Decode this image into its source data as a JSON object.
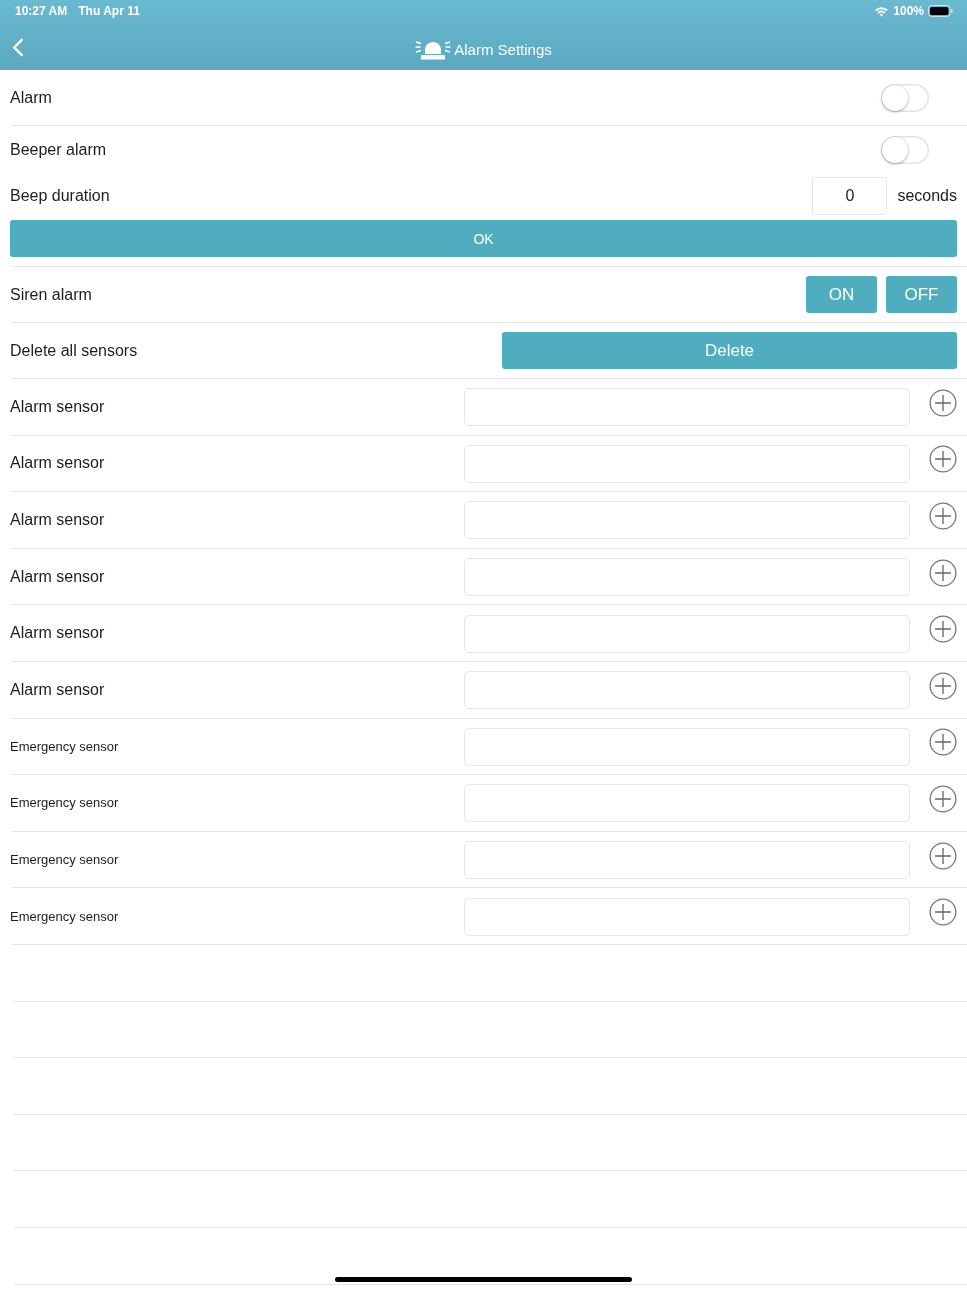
{
  "status_bar": {
    "time": "10:27 AM",
    "date": "Thu Apr 11",
    "battery": "100%"
  },
  "nav_bar": {
    "title": "Alarm Settings"
  },
  "settings": [
    {
      "kind": "toggle",
      "label": "Alarm",
      "on": false
    },
    {
      "kind": "toggle",
      "label": "Beeper alarm",
      "on": false
    },
    {
      "kind": "duration",
      "label": "Beep duration",
      "value": "0",
      "unit": "seconds",
      "button": "OK"
    },
    {
      "kind": "choice",
      "label": "Siren alarm",
      "options": [
        "ON",
        "OFF"
      ]
    },
    {
      "kind": "action",
      "label": "Delete all sensors",
      "button": "Delete"
    }
  ],
  "sensors": [
    {
      "kind": "alarm",
      "label": "Alarm sensor"
    },
    {
      "kind": "alarm",
      "label": "Alarm sensor"
    },
    {
      "kind": "alarm",
      "label": "Alarm sensor"
    },
    {
      "kind": "alarm",
      "label": "Alarm sensor"
    },
    {
      "kind": "alarm",
      "label": "Alarm sensor"
    },
    {
      "kind": "alarm",
      "label": "Alarm sensor"
    },
    {
      "kind": "emergency",
      "label": "Emergency sensor"
    },
    {
      "kind": "emergency",
      "label": "Emergency sensor"
    },
    {
      "kind": "emergency",
      "label": "Emergency sensor"
    },
    {
      "kind": "emergency",
      "label": "Emergency sensor"
    }
  ]
}
